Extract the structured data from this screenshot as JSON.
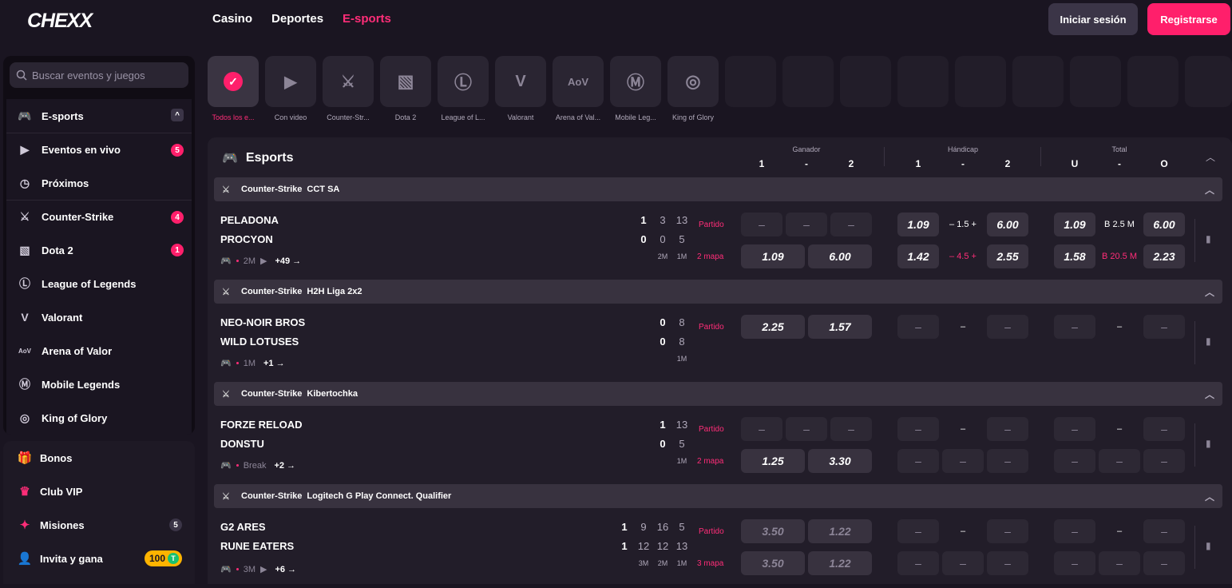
{
  "header": {
    "logo": "CHEXX",
    "nav": [
      "Casino",
      "Deportes",
      "E-sports"
    ],
    "active_nav": "E-sports",
    "login": "Iniciar sesión",
    "register": "Registrarse"
  },
  "sidebar": {
    "search_placeholder": "Buscar eventos y juegos",
    "items": [
      {
        "label": "E-sports",
        "icon": "gamepad-icon"
      },
      {
        "label": "Eventos en vivo",
        "icon": "play-icon",
        "badge": "5"
      },
      {
        "label": "Próximos",
        "icon": "clock-icon"
      },
      {
        "label": "Counter-Strike",
        "icon": "cs-icon",
        "badge": "4"
      },
      {
        "label": "Dota 2",
        "icon": "dota-icon",
        "badge": "1"
      },
      {
        "label": "League of Legends",
        "icon": "lol-icon"
      },
      {
        "label": "Valorant",
        "icon": "valorant-icon"
      },
      {
        "label": "Arena of Valor",
        "icon": "aov-icon"
      },
      {
        "label": "Mobile Legends",
        "icon": "ml-icon"
      },
      {
        "label": "King of Glory",
        "icon": "kog-icon"
      }
    ]
  },
  "sidebar2": {
    "items": [
      {
        "label": "Bonos",
        "icon": "gift-icon"
      },
      {
        "label": "Club VIP",
        "icon": "crown-icon"
      },
      {
        "label": "Misiones",
        "icon": "mission-icon",
        "count": "5"
      },
      {
        "label": "Invita y gana",
        "icon": "invite-icon",
        "coin": "100",
        "coin_symbol": "T"
      }
    ]
  },
  "games": [
    {
      "label": "Todos los e...",
      "icon": "check-icon",
      "active": true
    },
    {
      "label": "Con video",
      "icon": "video-icon"
    },
    {
      "label": "Counter-Str...",
      "icon": "cs-icon"
    },
    {
      "label": "Dota 2",
      "icon": "dota-icon"
    },
    {
      "label": "League of L...",
      "icon": "lol-icon"
    },
    {
      "label": "Valorant",
      "icon": "valorant-icon"
    },
    {
      "label": "Arena of Val...",
      "icon": "aov-icon",
      "text": "AoV"
    },
    {
      "label": "Mobile Leg...",
      "icon": "ml-icon"
    },
    {
      "label": "King of Glory",
      "icon": "kog-icon"
    }
  ],
  "panel": {
    "title": "Esports",
    "groups": [
      {
        "name": "Ganador",
        "cols": [
          "1",
          "-",
          "2"
        ]
      },
      {
        "name": "Hándicap",
        "cols": [
          "1",
          "-",
          "2"
        ]
      },
      {
        "name": "Total",
        "cols": [
          "U",
          "-",
          "O"
        ]
      }
    ]
  },
  "matches": [
    {
      "game": "Counter-Strike",
      "league": "CCT SA",
      "team1": "PELADONA",
      "team2": "PROCYON",
      "scores1": [
        "1",
        "3",
        "13"
      ],
      "scores2": [
        "0",
        "0",
        "5"
      ],
      "periods": [
        "2M",
        "1M"
      ],
      "meta": "2M",
      "video": true,
      "more": "+49 →",
      "row1": {
        "market": "Partido",
        "w1": "–",
        "wx": "–",
        "w2": "–",
        "h1": "1.09",
        "hl": "– 1.5 +",
        "h2": "6.00",
        "t1": "1.09",
        "tl": "B 2.5 M",
        "t2": "6.00"
      },
      "row2": {
        "market": "2 mapa",
        "w1": "1.09",
        "w2": "6.00",
        "h1": "1.42",
        "hl": "– 4.5 +",
        "h2": "2.55",
        "t1": "1.58",
        "tl": "B 20.5 M",
        "t2": "2.23"
      }
    },
    {
      "game": "Counter-Strike",
      "league": "H2H Liga 2x2",
      "team1": "NEO-NOIR BROS",
      "team2": "WILD LOTUSES",
      "scores1": [
        "0",
        "8"
      ],
      "scores2": [
        "0",
        "8"
      ],
      "periods": [
        "1M"
      ],
      "meta": "1M",
      "video": false,
      "more": "+1 →",
      "row1": {
        "market": "Partido",
        "w1": "2.25",
        "w2": "1.57",
        "h1": "–",
        "hl": "–",
        "h2": "–",
        "t1": "–",
        "tl": "–",
        "t2": "–"
      }
    },
    {
      "game": "Counter-Strike",
      "league": "Kibertochka",
      "team1": "FORZE RELOAD",
      "team2": "DONSTU",
      "scores1": [
        "1",
        "13"
      ],
      "scores2": [
        "0",
        "5"
      ],
      "periods": [
        "1M"
      ],
      "meta": "Break",
      "video": false,
      "more": "+2 →",
      "row1": {
        "market": "Partido",
        "w1": "–",
        "wx": "–",
        "w2": "–",
        "h1": "–",
        "hl": "–",
        "h2": "–",
        "t1": "–",
        "tl": "–",
        "t2": "–"
      },
      "row2": {
        "market": "2 mapa",
        "w1": "1.25",
        "w2": "3.30",
        "h1": "–",
        "hx": "–",
        "h2": "–",
        "t1": "–",
        "tx": "–",
        "t2": "–"
      }
    },
    {
      "game": "Counter-Strike",
      "league": "Logitech G Play Connect. Qualifier",
      "team1": "G2 ARES",
      "team2": "RUNE EATERS",
      "scores1": [
        "1",
        "9",
        "16",
        "5"
      ],
      "scores2": [
        "1",
        "12",
        "12",
        "13"
      ],
      "periods": [
        "3M",
        "2M",
        "1M"
      ],
      "meta": "3M",
      "video": true,
      "more": "+6 →",
      "row1": {
        "market": "Partido",
        "w1": "3.50",
        "w2": "1.22",
        "h1": "–",
        "hl": "–",
        "h2": "–",
        "t1": "–",
        "tl": "–",
        "t2": "–"
      },
      "row2": {
        "market": "3 mapa",
        "w1": "3.50",
        "w2": "1.22",
        "h1": "–",
        "hx": "–",
        "h2": "–",
        "t1": "–",
        "tx": "–",
        "t2": "–"
      }
    }
  ]
}
